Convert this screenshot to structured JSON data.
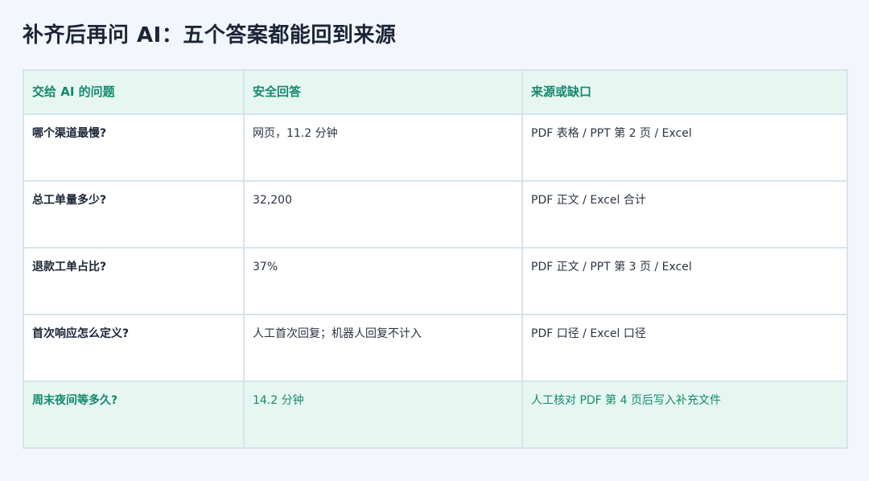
{
  "page": {
    "title": "补齐后再问 AI：五个答案都能回到来源"
  },
  "table": {
    "headers": [
      "交给 AI 的问题",
      "安全回答",
      "来源或缺口"
    ],
    "rows": [
      {
        "question": "哪个渠道最慢?",
        "answer": "网页，11.2 分钟",
        "source": "PDF 表格 / PPT 第 2 页 / Excel",
        "highlight": false
      },
      {
        "question": "总工单量多少?",
        "answer": "32,200",
        "source": "PDF 正文 / Excel 合计",
        "highlight": false
      },
      {
        "question": "退款工单占比?",
        "answer": "37%",
        "source": "PDF 正文 / PPT 第 3 页 / Excel",
        "highlight": false
      },
      {
        "question": "首次响应怎么定义?",
        "answer": "人工首次回复；机器人回复不计入",
        "source": "PDF 口径 / Excel 口径",
        "highlight": false
      },
      {
        "question": "周末夜间等多久?",
        "answer": "14.2 分钟",
        "source": "人工核对 PDF 第 4 页后写入补充文件",
        "highlight": true
      }
    ]
  },
  "colors": {
    "background": "#f3f6fc",
    "accent": "#14896d",
    "header_bg": "#e6f6f1",
    "border": "#d7e3ee",
    "text": "#1b2537"
  }
}
